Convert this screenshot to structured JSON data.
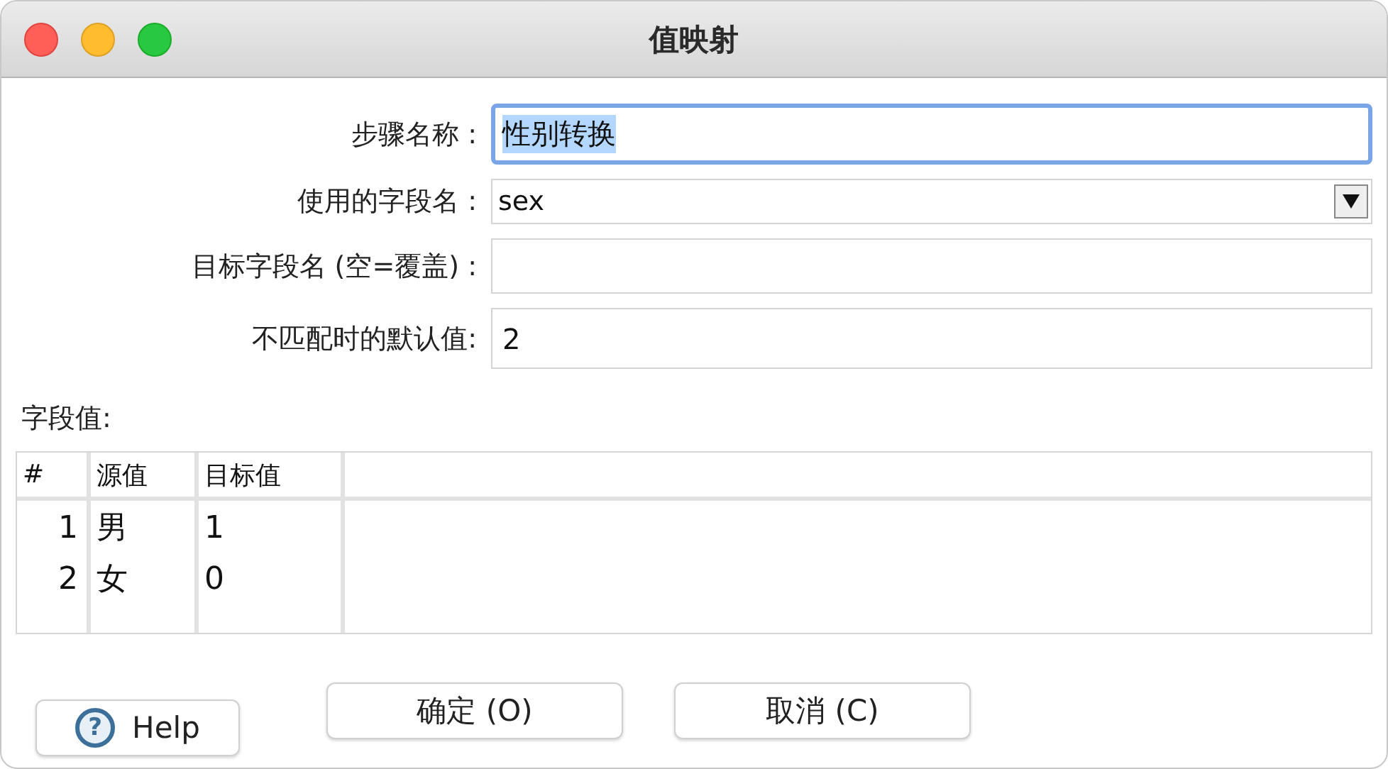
{
  "window": {
    "title": "值映射"
  },
  "form": [
    {
      "kind": "text",
      "label": "步骤名称 :",
      "value": "性别转换",
      "focused": true,
      "text_selected": true
    },
    {
      "kind": "dropdown",
      "label": "使用的字段名 :",
      "value": "sex"
    },
    {
      "kind": "text",
      "label": "目标字段名 (空=覆盖) :",
      "focused": false
    },
    {
      "kind": "text",
      "label": "不匹配时的默认值:",
      "value": "2",
      "focused": false,
      "text_selected": false
    }
  ],
  "table": {
    "title": "字段值:",
    "columns": [
      "#",
      "源值",
      "目标值"
    ],
    "rows": [
      {
        "cells": [
          "1",
          "男",
          "1"
        ]
      },
      {
        "cells": [
          "2",
          "女",
          "0"
        ]
      }
    ]
  },
  "help_button": {
    "icon_glyph": "?",
    "label": "Help"
  },
  "buttons": [
    "确定 (O)",
    "取消 (C)"
  ]
}
